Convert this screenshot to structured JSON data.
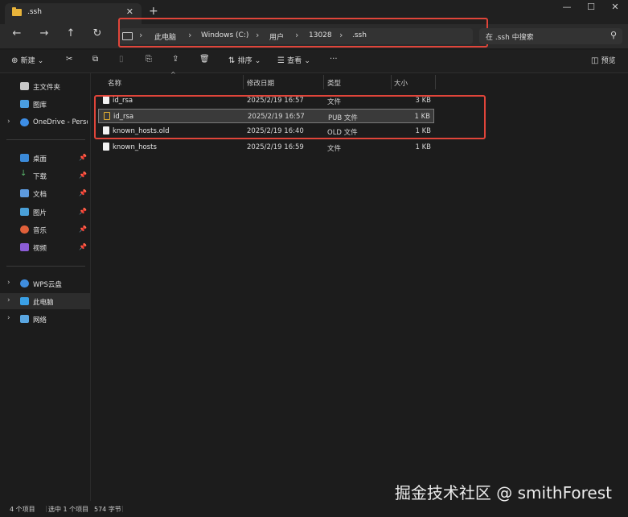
{
  "window": {
    "tab_title": ".ssh",
    "tab_close": "✕",
    "new_tab": "+",
    "minimize": "—",
    "maximize": "☐",
    "close": "✕"
  },
  "nav": {
    "back": "←",
    "forward": "→",
    "up": "↑",
    "refresh": "↻"
  },
  "breadcrumb": [
    "此电脑",
    "Windows (C:)",
    "用户",
    "13028",
    ".ssh"
  ],
  "search": {
    "placeholder": "在 .ssh 中搜索"
  },
  "toolbar": {
    "new_label": "新建",
    "sort_label": "排序",
    "view_label": "查看",
    "more": "···",
    "preview_label": "预览"
  },
  "sidebar": {
    "top": [
      {
        "label": "主文件夹",
        "icon": "home-icon"
      },
      {
        "label": "图库",
        "icon": "gallery-icon"
      },
      {
        "label": "OneDrive - Perso",
        "icon": "onedrive-icon"
      }
    ],
    "quick": [
      {
        "label": "桌面",
        "icon": "desktop-icon"
      },
      {
        "label": "下载",
        "icon": "download-icon"
      },
      {
        "label": "文档",
        "icon": "document-icon"
      },
      {
        "label": "图片",
        "icon": "picture-icon"
      },
      {
        "label": "音乐",
        "icon": "music-icon"
      },
      {
        "label": "视频",
        "icon": "video-icon"
      }
    ],
    "drives": [
      {
        "label": "WPS云盘",
        "icon": "cloud-icon"
      },
      {
        "label": "此电脑",
        "icon": "pc-icon"
      },
      {
        "label": "网络",
        "icon": "network-icon"
      }
    ]
  },
  "columns": {
    "name": "名称",
    "date": "修改日期",
    "type": "类型",
    "size": "大小"
  },
  "files": [
    {
      "name": "id_rsa",
      "date": "2025/2/19 16:57",
      "type": "文件",
      "size": "3 KB"
    },
    {
      "name": "id_rsa",
      "date": "2025/2/19 16:57",
      "type": "PUB 文件",
      "size": "1 KB"
    },
    {
      "name": "known_hosts.old",
      "date": "2025/2/19 16:40",
      "type": "OLD 文件",
      "size": "1 KB"
    },
    {
      "name": "known_hosts",
      "date": "2025/2/19 16:59",
      "type": "文件",
      "size": "1 KB"
    }
  ],
  "status": {
    "count": "4 个项目",
    "selected": "选中 1 个项目",
    "bytes": "574 字节"
  },
  "watermark": "掘金技术社区 @ smithForest",
  "colors": {
    "background": "#1c1c1c",
    "annotation_red": "#e0453a",
    "folder_yellow": "#e8b33a"
  }
}
